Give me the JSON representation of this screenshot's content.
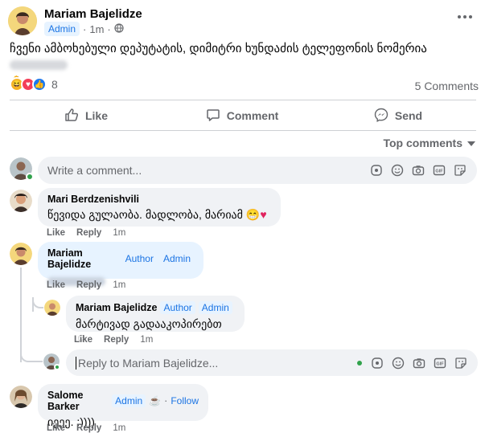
{
  "post": {
    "author": "Mariam Bajelidze",
    "badge": "Admin",
    "time": "1m",
    "text": "ჩვენი ამბოხებული დეპუტატის, დიმიტრი ხუნდაძის ტელეფონის ნომერია",
    "reaction_count": "8",
    "comment_count": "5 Comments"
  },
  "actions": {
    "like": "Like",
    "comment": "Comment",
    "send": "Send"
  },
  "sort": {
    "label": "Top comments"
  },
  "composer": {
    "placeholder": "Write a comment..."
  },
  "comments": [
    {
      "name": "Mari Berdzenishvili",
      "text": "წევიდა გულაობა. მადლობა, მარიამ",
      "like": "Like",
      "reply": "Reply",
      "time": "1m"
    },
    {
      "name": "Mariam Bajelidze",
      "tag1": "Author",
      "tag2": "Admin",
      "like": "Like",
      "reply": "Reply",
      "time": "1m"
    },
    {
      "name": "Mariam Bajelidze",
      "tag1": "Author",
      "tag2": "Admin",
      "text": "მარტივად გადააკოპირებთ",
      "like": "Like",
      "reply": "Reply",
      "time": "1m"
    },
    {
      "name": "Salome Barker",
      "tag1": "Admin",
      "follow": "Follow",
      "text": "იეეე. :))))",
      "like": "Like",
      "reply": "Reply",
      "time": "1m"
    }
  ],
  "reply_box": {
    "placeholder": "Reply to Mariam Bajelidze..."
  },
  "colors": {
    "accent": "#1b74e4",
    "bubble": "#f0f2f5",
    "highlight": "#e7f3ff",
    "online": "#31a24c"
  }
}
